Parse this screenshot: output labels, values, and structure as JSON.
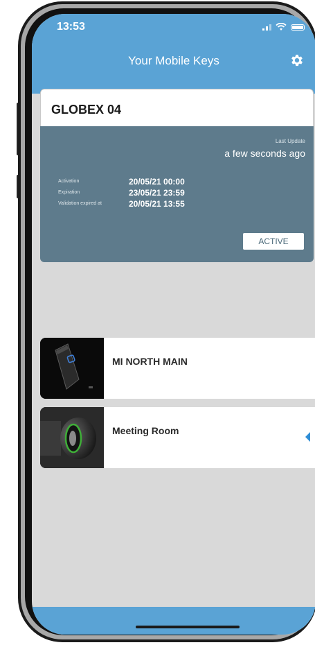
{
  "status_bar": {
    "time": "13:53"
  },
  "header": {
    "title": "Your Mobile Keys",
    "settings_icon": "gear-icon"
  },
  "key_card": {
    "name": "GLOBEX 04",
    "last_update_label": "Last Update",
    "last_update_value": "a few seconds ago",
    "details": [
      {
        "label": "Activation",
        "value": "20/05/21 00:00"
      },
      {
        "label": "Expiration",
        "value": "23/05/21 23:59"
      },
      {
        "label": "Validation expired at",
        "value": "20/05/21 13:55"
      }
    ],
    "status": "ACTIVE"
  },
  "doors": [
    {
      "name": "MI NORTH MAIN",
      "image": "card-reader-image"
    },
    {
      "name": "Meeting Room",
      "image": "door-lock-cylinder-image"
    }
  ],
  "colors": {
    "header": "#5aa3d5",
    "card": "#5e7b8c",
    "background": "#d9d9d9",
    "accent": "#2f8ed6"
  }
}
